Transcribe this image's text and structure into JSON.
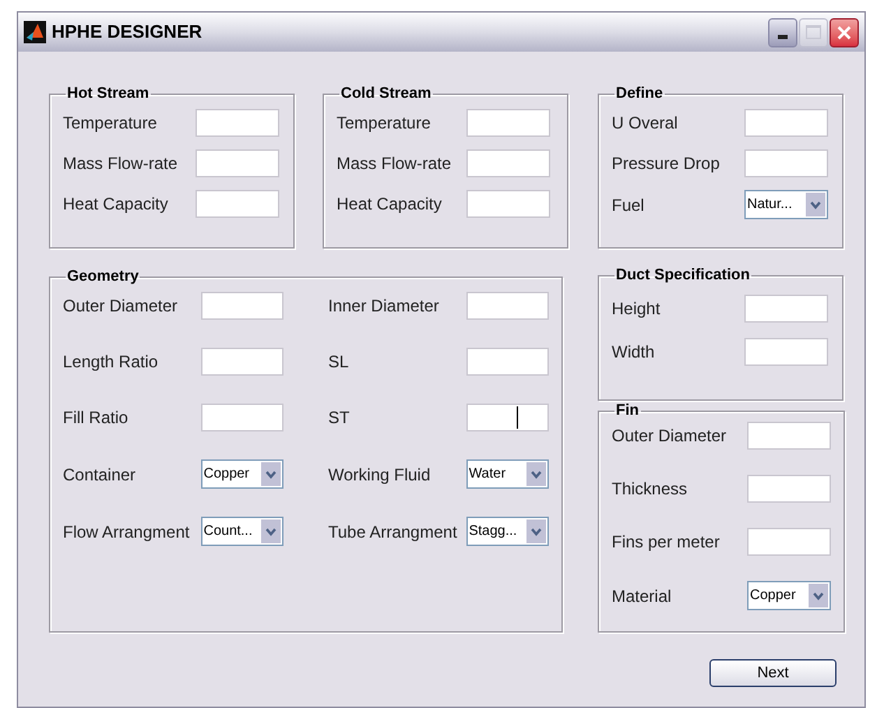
{
  "window": {
    "title": "HPHE DESIGNER"
  },
  "hot_stream": {
    "title": "Hot Stream",
    "fields": [
      {
        "label": "Temperature",
        "kind": "text",
        "focused": false
      },
      {
        "label": "Mass Flow-rate",
        "kind": "text",
        "focused": false
      },
      {
        "label": "Heat Capacity",
        "kind": "text",
        "focused": false
      }
    ]
  },
  "cold_stream": {
    "title": "Cold Stream",
    "fields": [
      {
        "label": "Temperature",
        "kind": "text",
        "focused": false
      },
      {
        "label": "Mass Flow-rate",
        "kind": "text",
        "focused": false
      },
      {
        "label": "Heat Capacity",
        "kind": "text",
        "focused": false
      }
    ]
  },
  "geometry": {
    "title": "Geometry",
    "fields": [
      {
        "label": "Outer Diameter",
        "kind": "text",
        "focused": false
      },
      {
        "label": "Inner Diameter",
        "kind": "text",
        "focused": false
      },
      {
        "label": "Length Ratio",
        "kind": "text",
        "focused": false
      },
      {
        "label": "SL",
        "kind": "text",
        "focused": false
      },
      {
        "label": "Fill Ratio",
        "kind": "text",
        "focused": false
      },
      {
        "label": "ST",
        "kind": "text",
        "focused": true
      },
      {
        "label": "Container",
        "kind": "dropdown",
        "value": "Copper"
      },
      {
        "label": "Working Fluid",
        "kind": "dropdown",
        "value": "Water"
      },
      {
        "label": "Flow Arrangment",
        "kind": "dropdown",
        "value": "Count..."
      },
      {
        "label": "Tube Arrangment",
        "kind": "dropdown",
        "value": "Stagg..."
      }
    ]
  },
  "define": {
    "title": "Define",
    "fields": [
      {
        "label": "U Overal",
        "kind": "text",
        "focused": false
      },
      {
        "label": "Pressure Drop",
        "kind": "text",
        "focused": false
      },
      {
        "label": "Fuel",
        "kind": "dropdown",
        "value": "Natur..."
      }
    ]
  },
  "duct_specification": {
    "title": "Duct Specification",
    "fields": [
      {
        "label": "Height",
        "kind": "text",
        "focused": false
      },
      {
        "label": "Width",
        "kind": "text",
        "focused": false
      }
    ]
  },
  "fin": {
    "title": "Fin",
    "fields": [
      {
        "label": "Outer Diameter",
        "kind": "text",
        "focused": false
      },
      {
        "label": "Thickness",
        "kind": "text",
        "focused": false
      },
      {
        "label": "Fins per meter",
        "kind": "text",
        "focused": false
      },
      {
        "label": "Material",
        "kind": "dropdown",
        "value": "Copper"
      }
    ]
  },
  "next_button": "Next"
}
